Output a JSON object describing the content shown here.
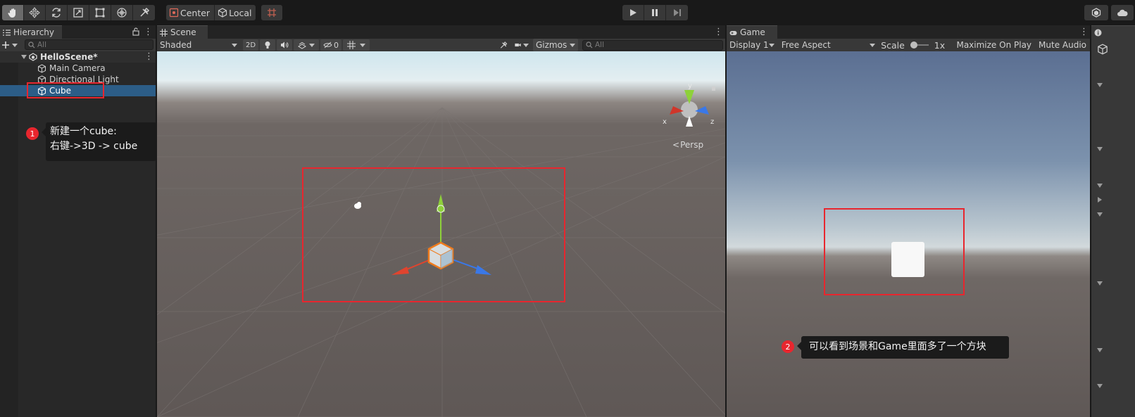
{
  "toolbar": {
    "tools": [
      "hand-tool",
      "move-tool",
      "rotate-tool",
      "scale-tool",
      "rect-tool",
      "transform-tool",
      "custom-tool"
    ],
    "pivot_label": "Center",
    "handle_label": "Local",
    "play_controls": [
      "play",
      "pause",
      "step"
    ]
  },
  "hierarchy": {
    "tab_label": "Hierarchy",
    "search_placeholder": "All",
    "scene_name": "HelloScene*",
    "items": [
      {
        "label": "Main Camera"
      },
      {
        "label": "Directional Light"
      },
      {
        "label": "Cube",
        "selected": true
      }
    ]
  },
  "annotations": {
    "step1": {
      "number": "1",
      "line1": "新建一个cube:",
      "line2": "右键->3D -> cube"
    },
    "step2": {
      "number": "2",
      "text": "可以看到场景和Game里面多了一个方块"
    },
    "box_color": "#e8262e"
  },
  "scene": {
    "tab_label": "Scene",
    "shading_mode": "Shaded",
    "mode_2d": "2D",
    "hidden_count": "0",
    "gizmos_label": "Gizmos",
    "search_placeholder": "All",
    "projection_label": "Persp",
    "axis_y": "y",
    "axis_x": "x",
    "axis_z": "z"
  },
  "game": {
    "tab_label": "Game",
    "display": "Display 1",
    "aspect": "Free Aspect",
    "scale_label": "Scale",
    "scale_value": "1x",
    "maximize_label": "Maximize On Play",
    "mute_label": "Mute Audio"
  },
  "colors": {
    "selection": "#2c5d87",
    "accent_red": "#e8262e",
    "axis_x": "#e0442e",
    "axis_y": "#8ed13a",
    "axis_z": "#3a78e8"
  }
}
